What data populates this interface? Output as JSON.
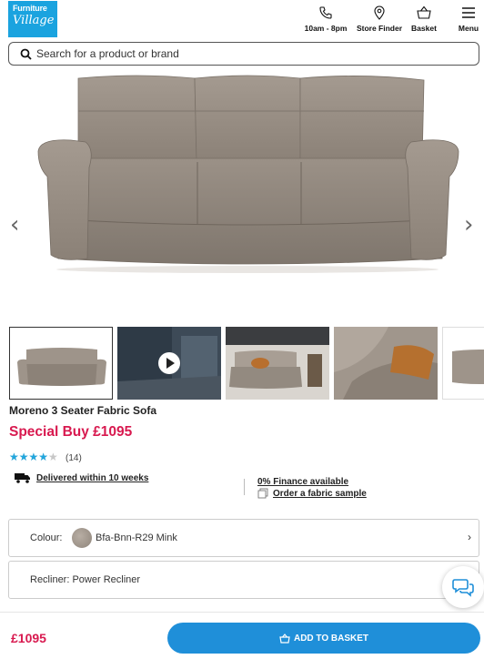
{
  "header": {
    "logo_line1": "Furniture",
    "logo_line2": "Village",
    "hours_label": "10am - 8pm",
    "store_label": "Store Finder",
    "basket_label": "Basket",
    "menu_label": "Menu"
  },
  "search": {
    "placeholder": "Search for a product or brand",
    "value": ""
  },
  "gallery": {
    "prev_arrow": "‹",
    "next_arrow": "›",
    "thumbnails": [
      {
        "kind": "image",
        "active": true
      },
      {
        "kind": "video",
        "active": false
      },
      {
        "kind": "image",
        "active": false
      },
      {
        "kind": "image",
        "active": false
      },
      {
        "kind": "image",
        "active": false
      }
    ]
  },
  "product": {
    "name": "Moreno 3 Seater Fabric Sofa",
    "price_label": "Special Buy £1095",
    "rating": 3.5,
    "rating_max": 5,
    "review_count": "(14)",
    "delivery": "Delivered within 10 weeks",
    "finance": "0% Finance available",
    "sample": "Order a fabric sample"
  },
  "options": {
    "colour_label": "Colour:",
    "colour_value": "Bfa-Bnn-R29 Mink",
    "recliner_label": "Recliner: Power Recliner"
  },
  "footer": {
    "price": "£1095",
    "add_to_basket": "ADD TO BASKET"
  },
  "colors": {
    "brand_blue": "#1aa3df",
    "price_pink": "#d8194f",
    "button_blue": "#1f8fd9",
    "star_blue": "#21a6dd"
  }
}
